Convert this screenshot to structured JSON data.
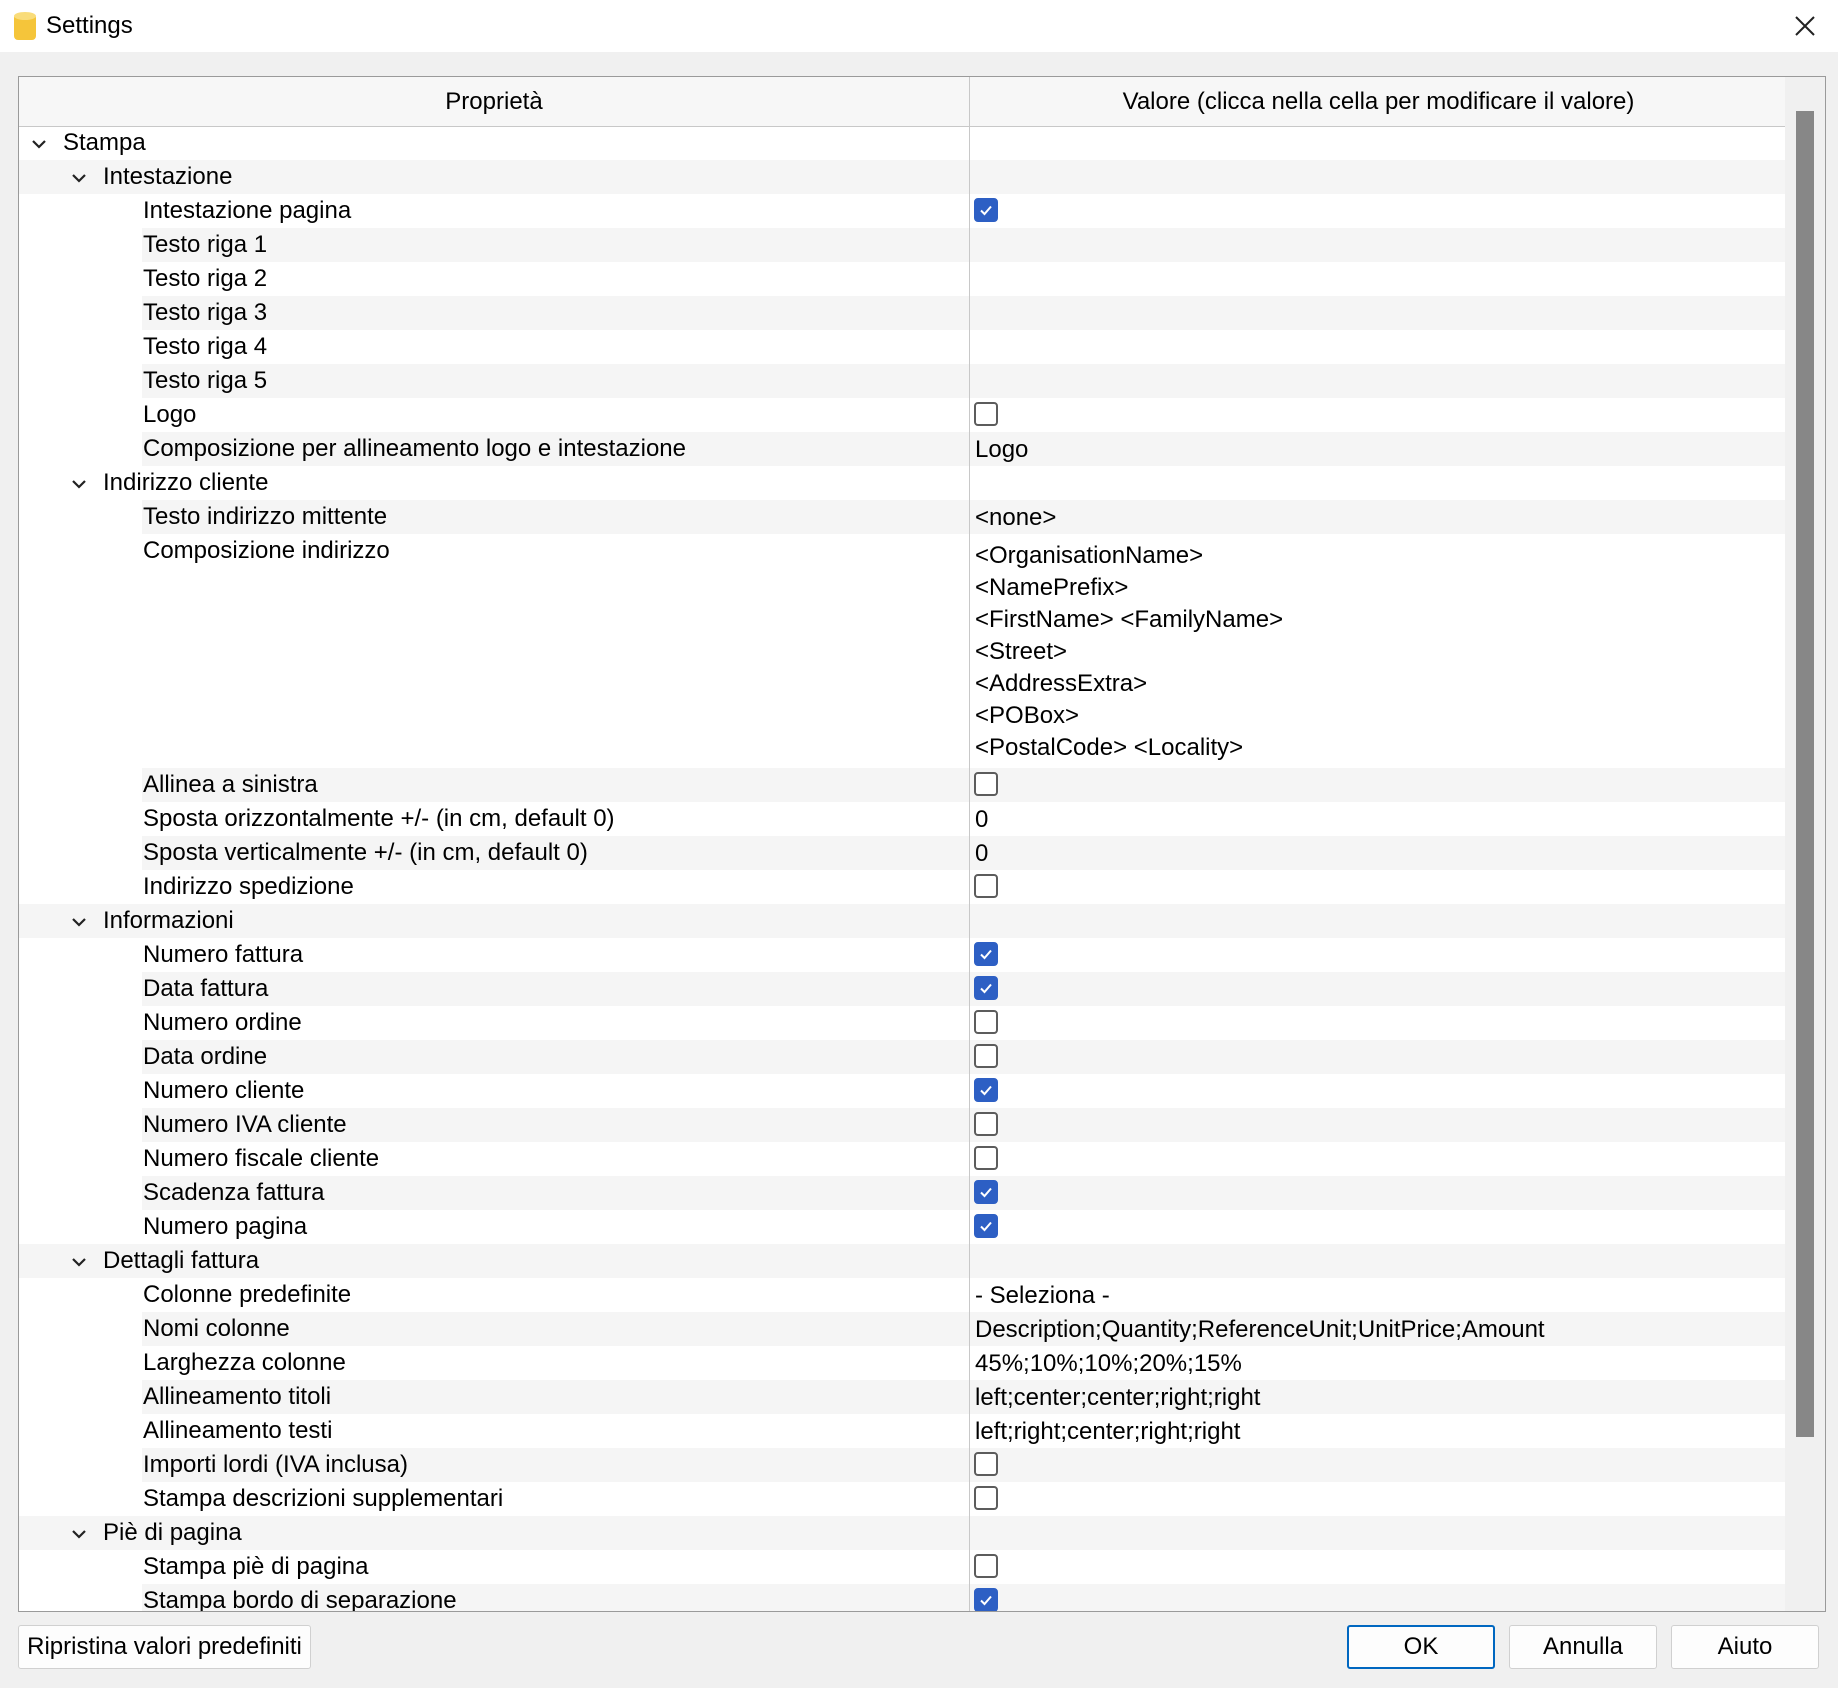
{
  "window": {
    "title": "Settings"
  },
  "table": {
    "col_property": "Proprietà",
    "col_value": "Valore (clicca nella cella per modificare il valore)"
  },
  "rows": [
    {
      "level": 0,
      "label": "Stampa",
      "group": true
    },
    {
      "level": 1,
      "label": "Intestazione",
      "group": true
    },
    {
      "level": 2,
      "label": "Intestazione pagina",
      "type": "checkbox",
      "checked": true
    },
    {
      "level": 2,
      "label": "Testo riga 1",
      "type": "text",
      "value": ""
    },
    {
      "level": 2,
      "label": "Testo riga 2",
      "type": "text",
      "value": ""
    },
    {
      "level": 2,
      "label": "Testo riga 3",
      "type": "text",
      "value": ""
    },
    {
      "level": 2,
      "label": "Testo riga 4",
      "type": "text",
      "value": ""
    },
    {
      "level": 2,
      "label": "Testo riga 5",
      "type": "text",
      "value": ""
    },
    {
      "level": 2,
      "label": "Logo",
      "type": "checkbox",
      "checked": false
    },
    {
      "level": 2,
      "label": "Composizione per allineamento logo e intestazione",
      "type": "text",
      "value": "Logo"
    },
    {
      "level": 1,
      "label": "Indirizzo cliente",
      "group": true
    },
    {
      "level": 2,
      "label": "Testo indirizzo mittente",
      "type": "text",
      "value": "<none>"
    },
    {
      "level": 2,
      "label": "Composizione indirizzo",
      "type": "multiline",
      "lines": [
        "<OrganisationName>",
        "<NamePrefix>",
        "<FirstName> <FamilyName>",
        "<Street>",
        "<AddressExtra>",
        "<POBox>",
        "<PostalCode> <Locality>"
      ]
    },
    {
      "level": 2,
      "label": "Allinea a sinistra",
      "type": "checkbox",
      "checked": false
    },
    {
      "level": 2,
      "label": "Sposta orizzontalmente +/- (in cm, default 0)",
      "type": "text",
      "value": "0"
    },
    {
      "level": 2,
      "label": "Sposta verticalmente +/- (in cm, default 0)",
      "type": "text",
      "value": "0"
    },
    {
      "level": 2,
      "label": "Indirizzo spedizione",
      "type": "checkbox",
      "checked": false
    },
    {
      "level": 1,
      "label": "Informazioni",
      "group": true
    },
    {
      "level": 2,
      "label": "Numero fattura",
      "type": "checkbox",
      "checked": true
    },
    {
      "level": 2,
      "label": "Data fattura",
      "type": "checkbox",
      "checked": true
    },
    {
      "level": 2,
      "label": "Numero ordine",
      "type": "checkbox",
      "checked": false
    },
    {
      "level": 2,
      "label": "Data ordine",
      "type": "checkbox",
      "checked": false
    },
    {
      "level": 2,
      "label": "Numero cliente",
      "type": "checkbox",
      "checked": true
    },
    {
      "level": 2,
      "label": "Numero IVA cliente",
      "type": "checkbox",
      "checked": false
    },
    {
      "level": 2,
      "label": "Numero fiscale cliente",
      "type": "checkbox",
      "checked": false
    },
    {
      "level": 2,
      "label": "Scadenza fattura",
      "type": "checkbox",
      "checked": true
    },
    {
      "level": 2,
      "label": "Numero pagina",
      "type": "checkbox",
      "checked": true
    },
    {
      "level": 1,
      "label": "Dettagli fattura",
      "group": true
    },
    {
      "level": 2,
      "label": "Colonne predefinite",
      "type": "text",
      "value": "- Seleziona -"
    },
    {
      "level": 2,
      "label": "Nomi colonne",
      "type": "text",
      "value": "Description;Quantity;ReferenceUnit;UnitPrice;Amount"
    },
    {
      "level": 2,
      "label": "Larghezza colonne",
      "type": "text",
      "value": "45%;10%;10%;20%;15%"
    },
    {
      "level": 2,
      "label": "Allineamento titoli",
      "type": "text",
      "value": "left;center;center;right;right"
    },
    {
      "level": 2,
      "label": "Allineamento testi",
      "type": "text",
      "value": "left;right;center;right;right"
    },
    {
      "level": 2,
      "label": "Importi lordi (IVA inclusa)",
      "type": "checkbox",
      "checked": false
    },
    {
      "level": 2,
      "label": "Stampa descrizioni supplementari",
      "type": "checkbox",
      "checked": false
    },
    {
      "level": 1,
      "label": "Piè di pagina",
      "group": true
    },
    {
      "level": 2,
      "label": "Stampa piè di pagina",
      "type": "checkbox",
      "checked": false
    },
    {
      "level": 2,
      "label": "Stampa bordo di separazione",
      "type": "checkbox",
      "checked": true
    }
  ],
  "buttons": {
    "reset": "Ripristina valori predefiniti",
    "ok": "OK",
    "cancel": "Annulla",
    "help": "Aiuto"
  },
  "colors": {
    "accent": "#2d5fc4",
    "app_icon": "#f5c53a"
  }
}
